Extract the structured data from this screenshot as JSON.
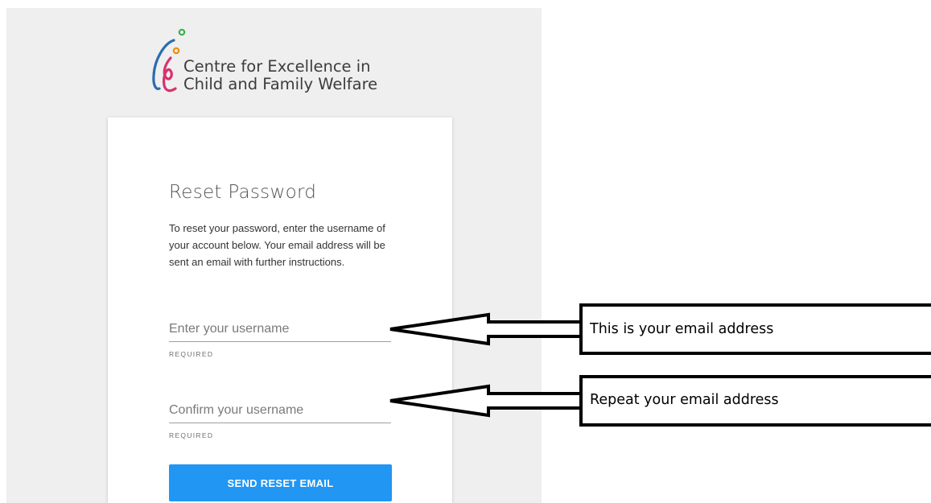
{
  "brand": {
    "line1": "Centre for Excellence in",
    "line2": "Child and Family Welfare",
    "colors": {
      "blue": "#2b6cb0",
      "pink": "#d6336c",
      "orange": "#f08c00",
      "green": "#37b24d"
    }
  },
  "card": {
    "title": "Reset Password",
    "description": "To reset your password, enter the username of your account below. Your email address will be sent an email with further instructions.",
    "username_placeholder": "Enter your username",
    "username_required": "REQUIRED",
    "confirm_placeholder": "Confirm your username",
    "confirm_required": "REQUIRED",
    "submit_label": "SEND RESET EMAIL",
    "accent_color": "#2196f3"
  },
  "annotations": [
    {
      "text": "This is your email address"
    },
    {
      "text": "Repeat your email address"
    }
  ]
}
